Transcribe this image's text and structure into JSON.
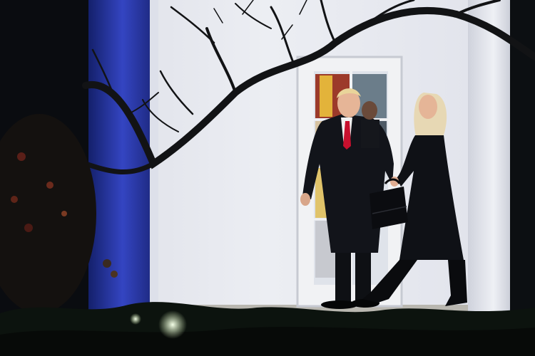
{
  "image": {
    "kind": "photograph",
    "colors": {
      "wall": "#e9eaf0",
      "wall_shadow": "#c9ccd8",
      "column_blue": "#2b3aa8",
      "night": "#07090c",
      "coat": "#101217",
      "tie": "#c8102e",
      "hair": "#e7d8b4",
      "hedge": "#0d140f"
    }
  }
}
